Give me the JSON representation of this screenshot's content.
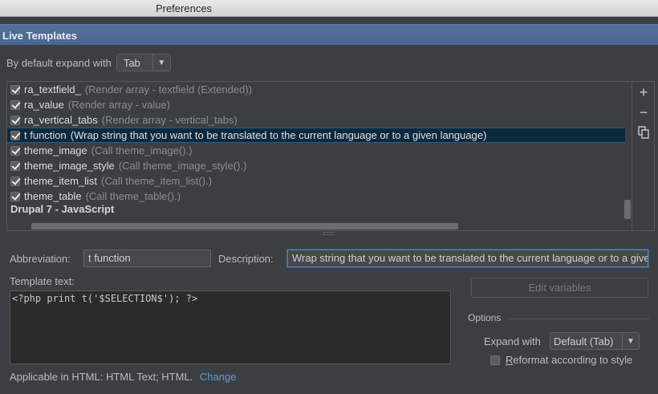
{
  "window": {
    "title": "Preferences"
  },
  "section": {
    "title": "Live Templates"
  },
  "expand_default": {
    "label": "By default expand with",
    "value": "Tab"
  },
  "templates": [
    {
      "name": "ra_textfield_",
      "desc": "(Render array - textfield (Extended))",
      "checked": true,
      "selected": false
    },
    {
      "name": "ra_value",
      "desc": "(Render array - value)",
      "checked": true,
      "selected": false
    },
    {
      "name": "ra_vertical_tabs",
      "desc": "(Render array - vertical_tabs)",
      "checked": true,
      "selected": false
    },
    {
      "name": "t function",
      "desc": "(Wrap string that you want to be translated to the current language or to a given language)",
      "checked": true,
      "selected": true
    },
    {
      "name": "theme_image",
      "desc": "(Call theme_image().)",
      "checked": true,
      "selected": false
    },
    {
      "name": "theme_image_style",
      "desc": "(Call theme_image_style().)",
      "checked": true,
      "selected": false
    },
    {
      "name": "theme_item_list",
      "desc": "(Call theme_item_list().)",
      "checked": true,
      "selected": false
    },
    {
      "name": "theme_table",
      "desc": "(Call theme_table().)",
      "checked": true,
      "selected": false
    }
  ],
  "group": {
    "label": "Drupal 7 - JavaScript"
  },
  "tools": {
    "add_icon": "plus-icon",
    "remove_icon": "minus-icon",
    "copy_icon": "copy-icon"
  },
  "abbreviation": {
    "label": "Abbreviation:",
    "value": "t function"
  },
  "description": {
    "label": "Description:",
    "value": "Wrap string that you want to be translated to the current language or to a given language"
  },
  "template_text": {
    "label": "Template text:",
    "code_prefix": "<?php print t('",
    "variable": "$SELECTION$",
    "code_suffix": "'); ?>"
  },
  "edit_variables": {
    "label": "Edit variables"
  },
  "options": {
    "title": "Options",
    "expand_with_label": "Expand with",
    "expand_with_value": "Default (Tab)",
    "reformat_mnemonic": "R",
    "reformat_rest": "eformat according to style",
    "reformat_checked": false
  },
  "applicable": {
    "text": "Applicable in HTML: HTML Text; HTML.",
    "link": "Change"
  },
  "colors": {
    "accent": "#4a6690",
    "selection": "#0d293e",
    "link": "#5b9bd5"
  }
}
